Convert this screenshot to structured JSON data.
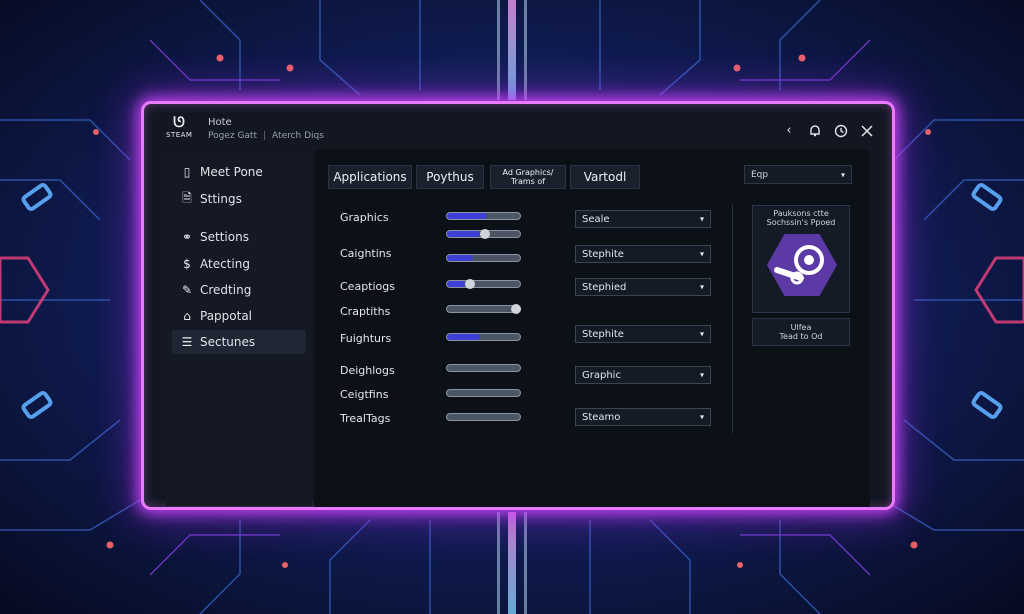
{
  "titlebar": {
    "logo_text": "STEAM",
    "title": "Hote",
    "subtitle_left": "Pogez Gatt",
    "subtitle_right": "Aterch Diqs",
    "icons": [
      "chevron-left-icon",
      "bell-icon",
      "clock-icon",
      "close-icon"
    ]
  },
  "sidebar": {
    "items": [
      {
        "label": "Meet Pone",
        "icon": "phone-icon"
      },
      {
        "label": "Sttings",
        "icon": "document-icon"
      },
      {
        "label": "Settions",
        "icon": "link-icon"
      },
      {
        "label": "Atecting",
        "icon": "dollar-icon"
      },
      {
        "label": "Credting",
        "icon": "pencil-icon"
      },
      {
        "label": "Pappotal",
        "icon": "tag-icon"
      },
      {
        "label": "Sectunes",
        "icon": "sliders-icon"
      }
    ],
    "active_index": 6
  },
  "tabs": [
    {
      "label": "Applications"
    },
    {
      "label": "Poythus"
    },
    {
      "label": "Ad Graphics/ Trams of"
    },
    {
      "label": "Vartodl"
    }
  ],
  "top_dropdown": {
    "value": "Eqp"
  },
  "settings": {
    "rows": [
      {
        "label": "Graphics"
      },
      {
        "label": "Caightins"
      },
      {
        "label": "Ceaptiogs"
      },
      {
        "label": "Craptiths"
      },
      {
        "label": "Fuighturs"
      },
      {
        "label": "Deighlogs"
      },
      {
        "label": "Ceigtfins"
      },
      {
        "label": "TrealTags"
      }
    ],
    "sliders": [
      {
        "level": 0.55,
        "knob": false
      },
      {
        "level": 0.45,
        "knob": true
      },
      {
        "level": 0.35,
        "knob": false
      },
      {
        "level": 0.25,
        "knob": true
      },
      {
        "level": 0.0,
        "knob": true
      },
      {
        "level": 0.45,
        "knob": false
      },
      {
        "level": 0.0,
        "knob": false
      },
      {
        "level": 0.0,
        "knob": false
      }
    ],
    "selects": [
      {
        "value": "Seale"
      },
      {
        "value": "Stephite"
      },
      {
        "value": "Stephied"
      },
      {
        "value": "Stephite"
      },
      {
        "value": "Graphic"
      },
      {
        "value": "Steamo"
      }
    ]
  },
  "card": {
    "header_line1": "Pauksons ctte",
    "header_line2": "Sochssin's Ppoed",
    "footer_line1": "Ulfea",
    "footer_line2": "Tead to Od"
  },
  "colors": {
    "accent_glow": "#ea7bff",
    "slider_fill": "#3f3fd8",
    "window_bg": "#121722",
    "steam_badge": "#5b3aa6"
  }
}
